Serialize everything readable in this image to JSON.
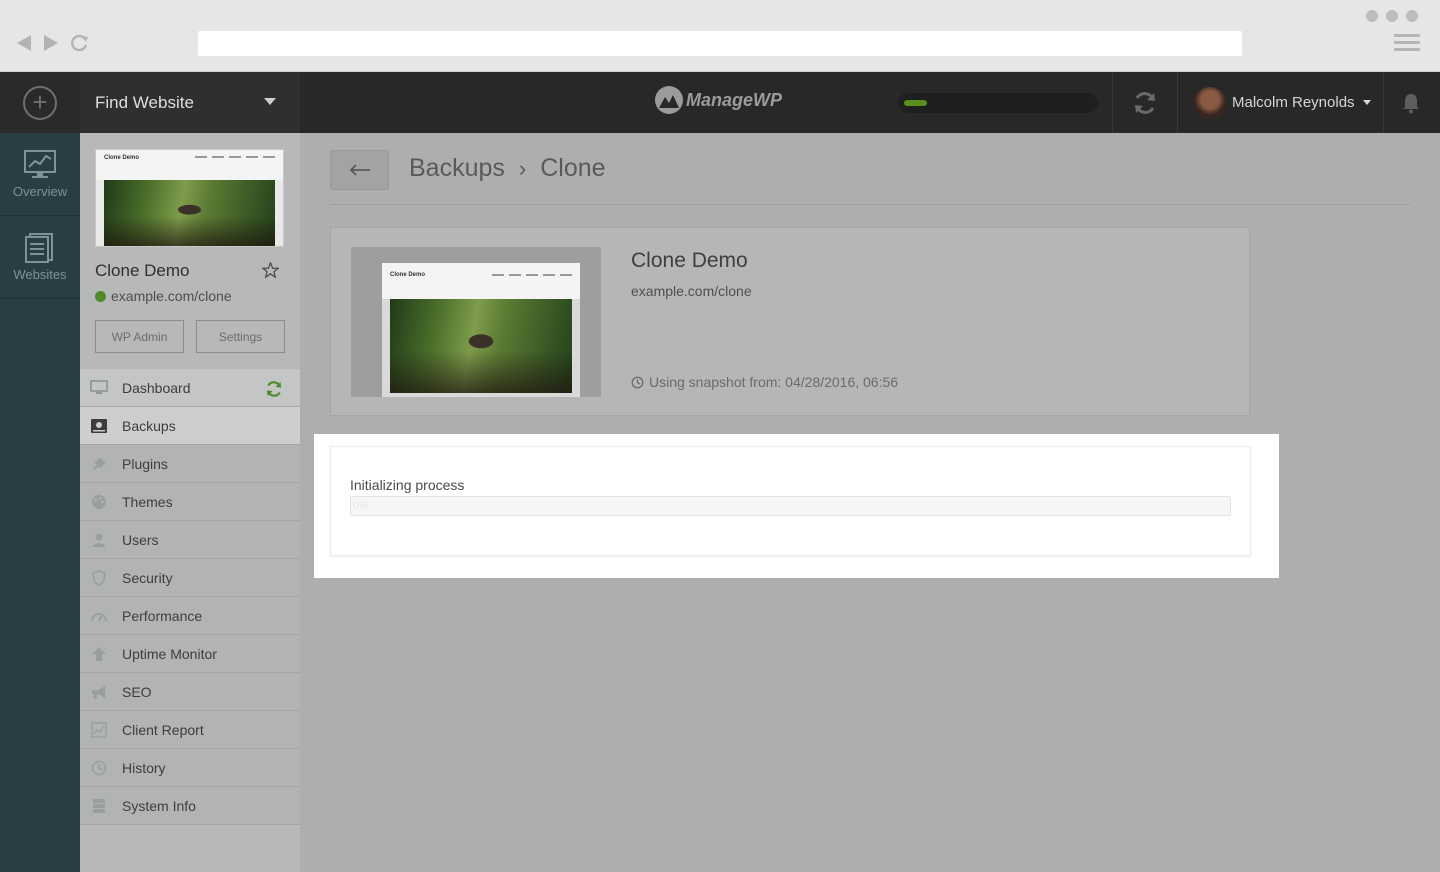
{
  "topbar": {
    "find_website": "Find Website",
    "logo_text": "ManageWP",
    "user_name": "Malcolm Reynolds",
    "global_progress_fraction": 0.12
  },
  "rail": {
    "items": [
      {
        "label": "Overview",
        "icon": "chart-monitor-icon"
      },
      {
        "label": "Websites",
        "icon": "websites-icon"
      }
    ]
  },
  "sidebar": {
    "site_name": "Clone Demo",
    "site_url": "example.com/clone",
    "wp_admin": "WP Admin",
    "settings": "Settings",
    "thumb_title": "Clone Demo",
    "menu": [
      {
        "label": "Dashboard",
        "icon": "monitor-icon"
      },
      {
        "label": "Backups",
        "icon": "backup-icon"
      },
      {
        "label": "Plugins",
        "icon": "plug-icon"
      },
      {
        "label": "Themes",
        "icon": "palette-icon"
      },
      {
        "label": "Users",
        "icon": "user-icon"
      },
      {
        "label": "Security",
        "icon": "shield-icon"
      },
      {
        "label": "Performance",
        "icon": "gauge-icon"
      },
      {
        "label": "Uptime Monitor",
        "icon": "arrow-up-icon"
      },
      {
        "label": "SEO",
        "icon": "megaphone-icon"
      },
      {
        "label": "Client Report",
        "icon": "report-icon"
      },
      {
        "label": "History",
        "icon": "clock-icon"
      },
      {
        "label": "System Info",
        "icon": "server-icon"
      }
    ]
  },
  "main": {
    "breadcrumb": [
      "Backups",
      "Clone"
    ],
    "card": {
      "title": "Clone Demo",
      "url": "example.com/clone",
      "snapshot": "Using snapshot from: 04/28/2016, 06:56"
    },
    "progress": {
      "label": "Initializing process",
      "percent": 0,
      "percent_text": "0%"
    }
  },
  "colors": {
    "accent_green": "#5a8f1b",
    "topbar": "#282828",
    "rail": "#2b3d44"
  }
}
